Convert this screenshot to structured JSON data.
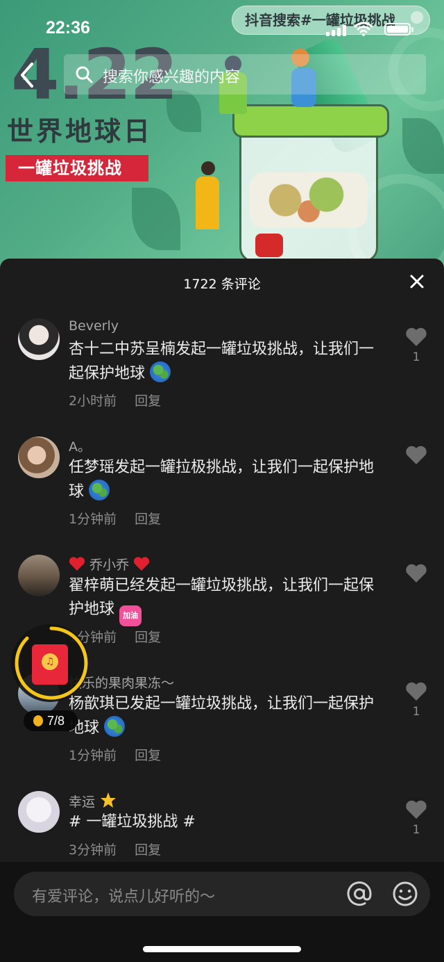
{
  "status_bar": {
    "time": "22:36"
  },
  "video": {
    "topic_pill": "抖音搜索#一罐垃圾挑战",
    "big_date": "4.22",
    "earth_day": "世界地球日",
    "challenge_tag": "一罐垃圾挑战"
  },
  "search": {
    "placeholder": "搜索你感兴趣的内容"
  },
  "comments_header": {
    "title": "1722 条评论"
  },
  "comments": [
    {
      "user": "Beverly",
      "text": "杏十二中苏呈楠发起一罐垃圾挑战，让我们一起保护地球",
      "time": "2小时前",
      "reply": "回复",
      "likes": "1",
      "emoji": "globe-emoji"
    },
    {
      "user": "A。",
      "text": "任梦瑶发起一罐拉极挑战，让我们一起保护地球",
      "time": "1分钟前",
      "reply": "回复",
      "likes": "",
      "emoji": "globe-emoji"
    },
    {
      "user": "乔小乔",
      "text": "翟梓萌已经发起一罐垃圾挑战，让我们一起保护地球",
      "time": "1分钟前",
      "reply": "回复",
      "likes": "",
      "emoji": "jiayou-emoji",
      "emoji_text": "加油"
    },
    {
      "user": "快乐的果肉果冻～",
      "text": "杨歆琪已发起一罐垃圾挑战，让我们一起保护地球",
      "time": "1分钟前",
      "reply": "回复",
      "likes": "1",
      "emoji": "globe-emoji"
    },
    {
      "user": "幸运",
      "text": "# 一罐垃圾挑战 #",
      "time": "3分钟前",
      "reply": "回复",
      "likes": "1",
      "emoji": "star-emoji"
    }
  ],
  "red_packet": {
    "progress": "7/8"
  },
  "input": {
    "placeholder": "有爱评论，说点儿好听的～"
  },
  "colors": {
    "sheet_bg": "#1c1c1c",
    "accent_red": "#e8283a",
    "ring_yellow": "#f5c518"
  }
}
